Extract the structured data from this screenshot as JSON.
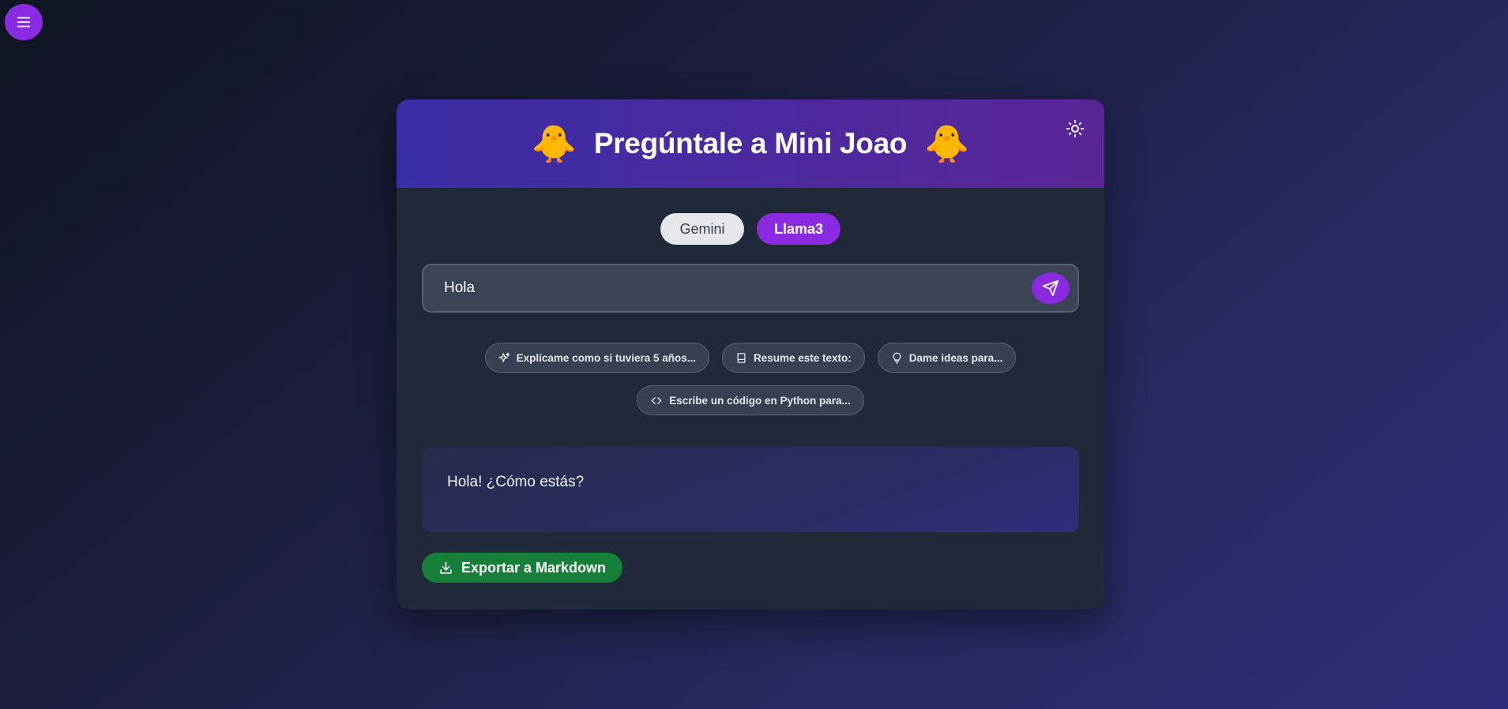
{
  "menu": {
    "icon": "menu-icon"
  },
  "header": {
    "title": "Pregúntale a Mini Joao",
    "emoji_left": "🐥",
    "emoji_right": "🐥",
    "theme_icon": "sun-icon"
  },
  "models": [
    {
      "label": "Gemini",
      "selected": false
    },
    {
      "label": "Llama3",
      "selected": true
    }
  ],
  "prompt": {
    "value": "Hola",
    "send_icon": "send-icon"
  },
  "suggestions": [
    {
      "label": "Explícame como si tuviera 5 años...",
      "icon": "sparkles-icon"
    },
    {
      "label": "Resume este texto:",
      "icon": "book-icon"
    },
    {
      "label": "Dame ideas para...",
      "icon": "lightbulb-icon"
    },
    {
      "label": "Escribe un código en Python para...",
      "icon": "code-icon"
    }
  ],
  "response": {
    "text": "Hola! ¿Cómo estás?"
  },
  "export": {
    "label": "Exportar a Markdown",
    "icon": "download-icon"
  },
  "colors": {
    "accent": "#8a2be2",
    "export_green": "#16803a",
    "card_bg": "#1f2937"
  }
}
